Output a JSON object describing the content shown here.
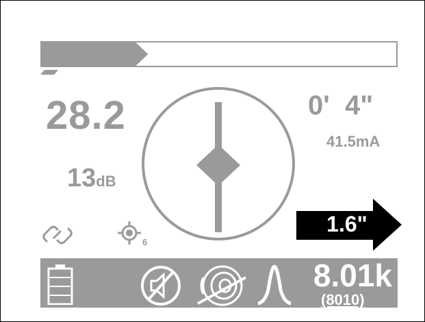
{
  "signal_strength": 0.3,
  "readings": {
    "signal_value": "28.2",
    "gain_value": "13",
    "gain_unit": "dB",
    "depth": "0'  4\"",
    "current": "41.5mA",
    "target_count": "6"
  },
  "guidance": {
    "offset": "1.6\"",
    "direction": "right"
  },
  "status": {
    "frequency": "8.01k",
    "frequency_exact": "(8010)"
  },
  "icons": {
    "link": "link-icon",
    "target": "target-icon",
    "battery": "battery-icon",
    "mute": "speaker-muted-icon",
    "sonde": "sonde-off-icon",
    "peak": "peak-mode-icon"
  },
  "colors": {
    "foreground": "#9a9a9a",
    "background": "#ffffff",
    "arrow": "#000000"
  }
}
